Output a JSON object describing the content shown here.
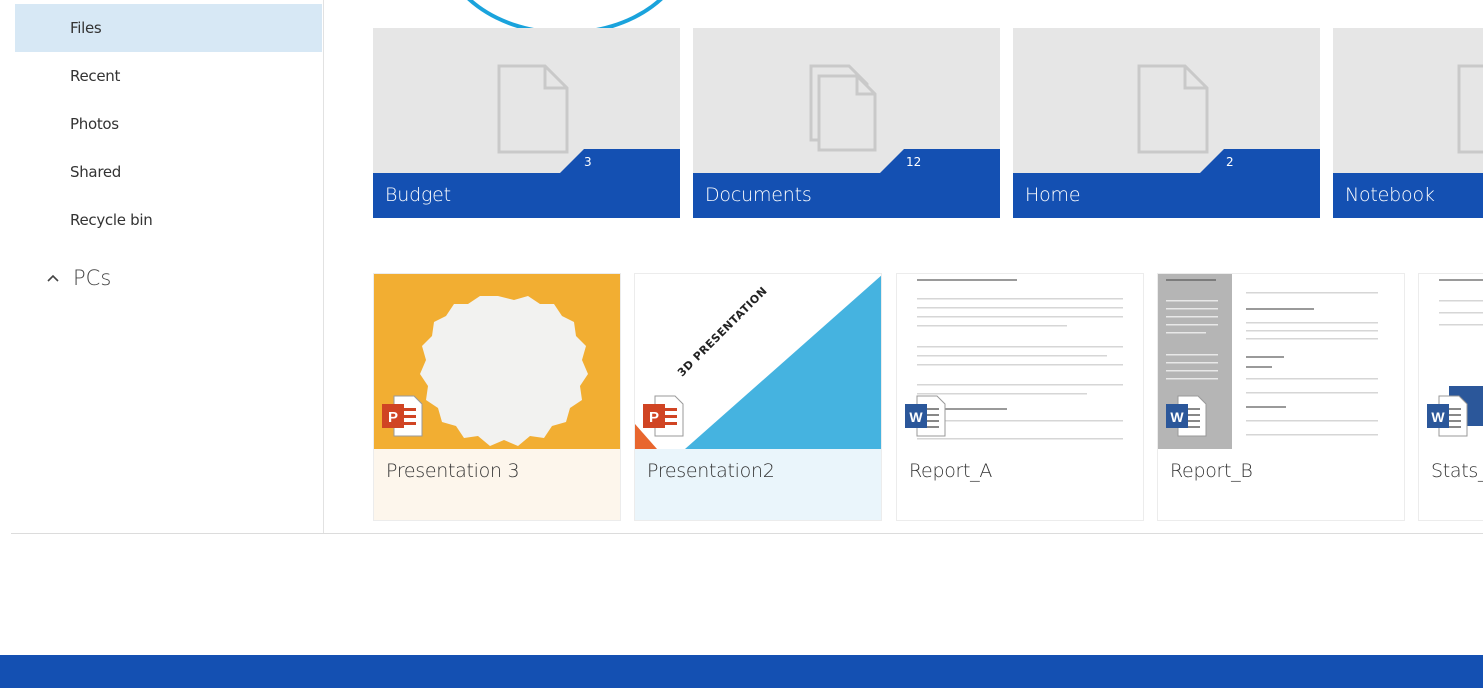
{
  "sidebar": {
    "items": [
      {
        "label": "Files",
        "active": true
      },
      {
        "label": "Recent",
        "active": false
      },
      {
        "label": "Photos",
        "active": false
      },
      {
        "label": "Shared",
        "active": false
      },
      {
        "label": "Recycle bin",
        "active": false
      }
    ],
    "section": {
      "label": "PCs",
      "icon": "chevron-up-icon"
    }
  },
  "folders": [
    {
      "name": "Budget",
      "count": "3",
      "icon": "document-icon"
    },
    {
      "name": "Documents",
      "count": "12",
      "icon": "documents-stack-icon"
    },
    {
      "name": "Home",
      "count": "2",
      "icon": "document-icon"
    },
    {
      "name": "Notebook",
      "count": "",
      "icon": "document-icon"
    }
  ],
  "files": [
    {
      "name": "Presentation 3",
      "type": "powerpoint",
      "icon": "powerpoint-icon"
    },
    {
      "name": "Presentation2",
      "type": "powerpoint",
      "icon": "powerpoint-icon",
      "thumb_text": "3D PRESENTATION"
    },
    {
      "name": "Report_A",
      "type": "word",
      "icon": "word-icon"
    },
    {
      "name": "Report_B",
      "type": "word",
      "icon": "word-icon"
    },
    {
      "name": "Stats_",
      "type": "word",
      "icon": "word-icon"
    }
  ],
  "colors": {
    "accent": "#1450b2",
    "sidebar_active": "#d7e8f5",
    "arc": "#1aa3dc",
    "presentation3_bg": "#f2ae32",
    "presentation2_bg": "#45b3e0",
    "powerpoint": "#d04423",
    "word": "#2b579a"
  }
}
